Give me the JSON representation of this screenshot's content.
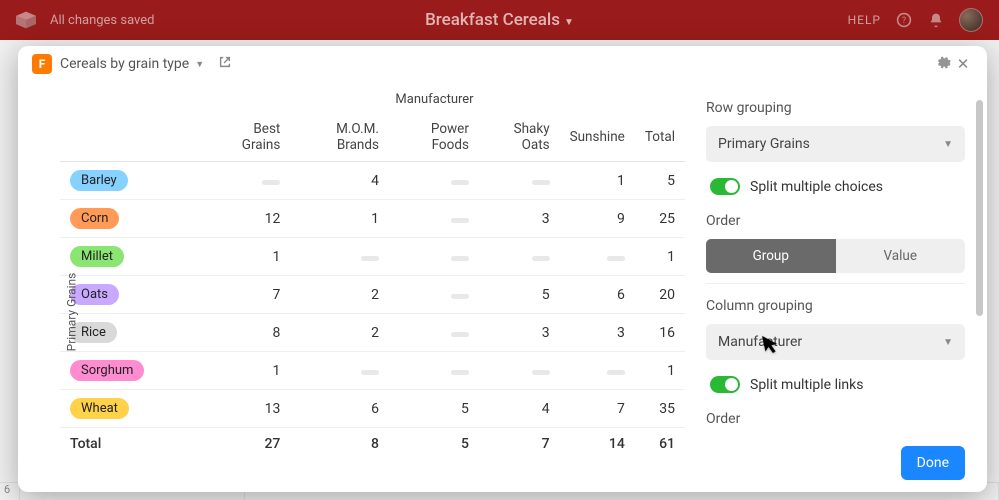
{
  "header": {
    "status": "All changes saved",
    "title": "Breakfast Cereals",
    "help": "HELP"
  },
  "modal": {
    "view_name": "Cereals by grain type",
    "col_super": "Manufacturer",
    "row_super": "Primary Grains",
    "columns": [
      "Best Grains",
      "M.O.M. Brands",
      "Power Foods",
      "Shaky Oats",
      "Sunshine",
      "Total"
    ],
    "total_label": "Total",
    "rows": [
      {
        "label": "Barley",
        "color": "#86d1ff",
        "cells": [
          null,
          4,
          null,
          null,
          1,
          5
        ]
      },
      {
        "label": "Corn",
        "color": "#ff9a57",
        "cells": [
          12,
          1,
          null,
          3,
          9,
          25
        ]
      },
      {
        "label": "Millet",
        "color": "#8ae572",
        "cells": [
          1,
          null,
          null,
          null,
          null,
          1
        ]
      },
      {
        "label": "Oats",
        "color": "#c9a8ff",
        "cells": [
          7,
          2,
          null,
          5,
          6,
          20
        ]
      },
      {
        "label": "Rice",
        "color": "#d9d9d9",
        "cells": [
          8,
          2,
          null,
          3,
          3,
          16
        ]
      },
      {
        "label": "Sorghum",
        "color": "#ff8bd1",
        "cells": [
          1,
          null,
          null,
          null,
          null,
          1
        ]
      },
      {
        "label": "Wheat",
        "color": "#ffd24a",
        "cells": [
          13,
          6,
          5,
          4,
          7,
          35
        ]
      }
    ],
    "totals": [
      27,
      8,
      5,
      7,
      14,
      61
    ]
  },
  "panel": {
    "row_grouping_label": "Row grouping",
    "row_grouping_value": "Primary Grains",
    "split_choices_label": "Split multiple choices",
    "order_label": "Order",
    "order_options": {
      "group": "Group",
      "value": "Value"
    },
    "col_grouping_label": "Column grouping",
    "col_grouping_value": "Manufacturer",
    "split_links_label": "Split multiple links",
    "order2_label": "Order"
  },
  "footer": {
    "done": "Done"
  },
  "bg": {
    "stub": "6"
  }
}
